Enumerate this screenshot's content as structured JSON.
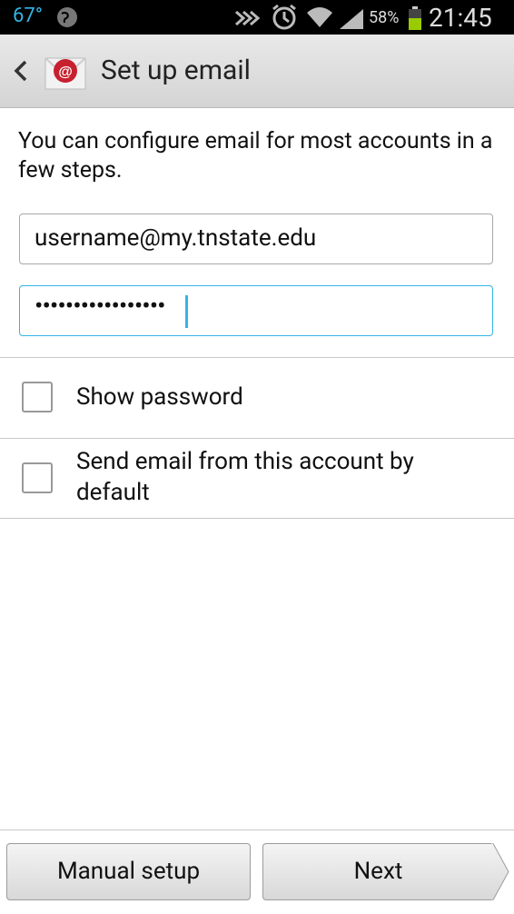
{
  "status_bar": {
    "temperature": "67°",
    "battery_percent": "58%",
    "time": "21:45",
    "icons": [
      "globe-icon",
      "nfc-icon",
      "alarm-icon",
      "wifi-icon",
      "signal-icon",
      "battery-icon"
    ]
  },
  "action_bar": {
    "back_icon": "back-chevron-icon",
    "app_icon": "email-app-icon",
    "title": "Set up email"
  },
  "intro_text": "You can configure email for most accounts in a few steps.",
  "email_field": {
    "value": "username@my.tnstate.edu"
  },
  "password_field": {
    "value": "•••••••••••••••••",
    "focused": true
  },
  "checkboxes": [
    {
      "label": "Show password",
      "checked": false
    },
    {
      "label": "Send email from this account by default",
      "checked": false
    }
  ],
  "buttons": {
    "manual_setup": "Manual setup",
    "next": "Next"
  },
  "colors": {
    "accent": "#33b5e5",
    "app_icon_red": "#c8202e"
  }
}
